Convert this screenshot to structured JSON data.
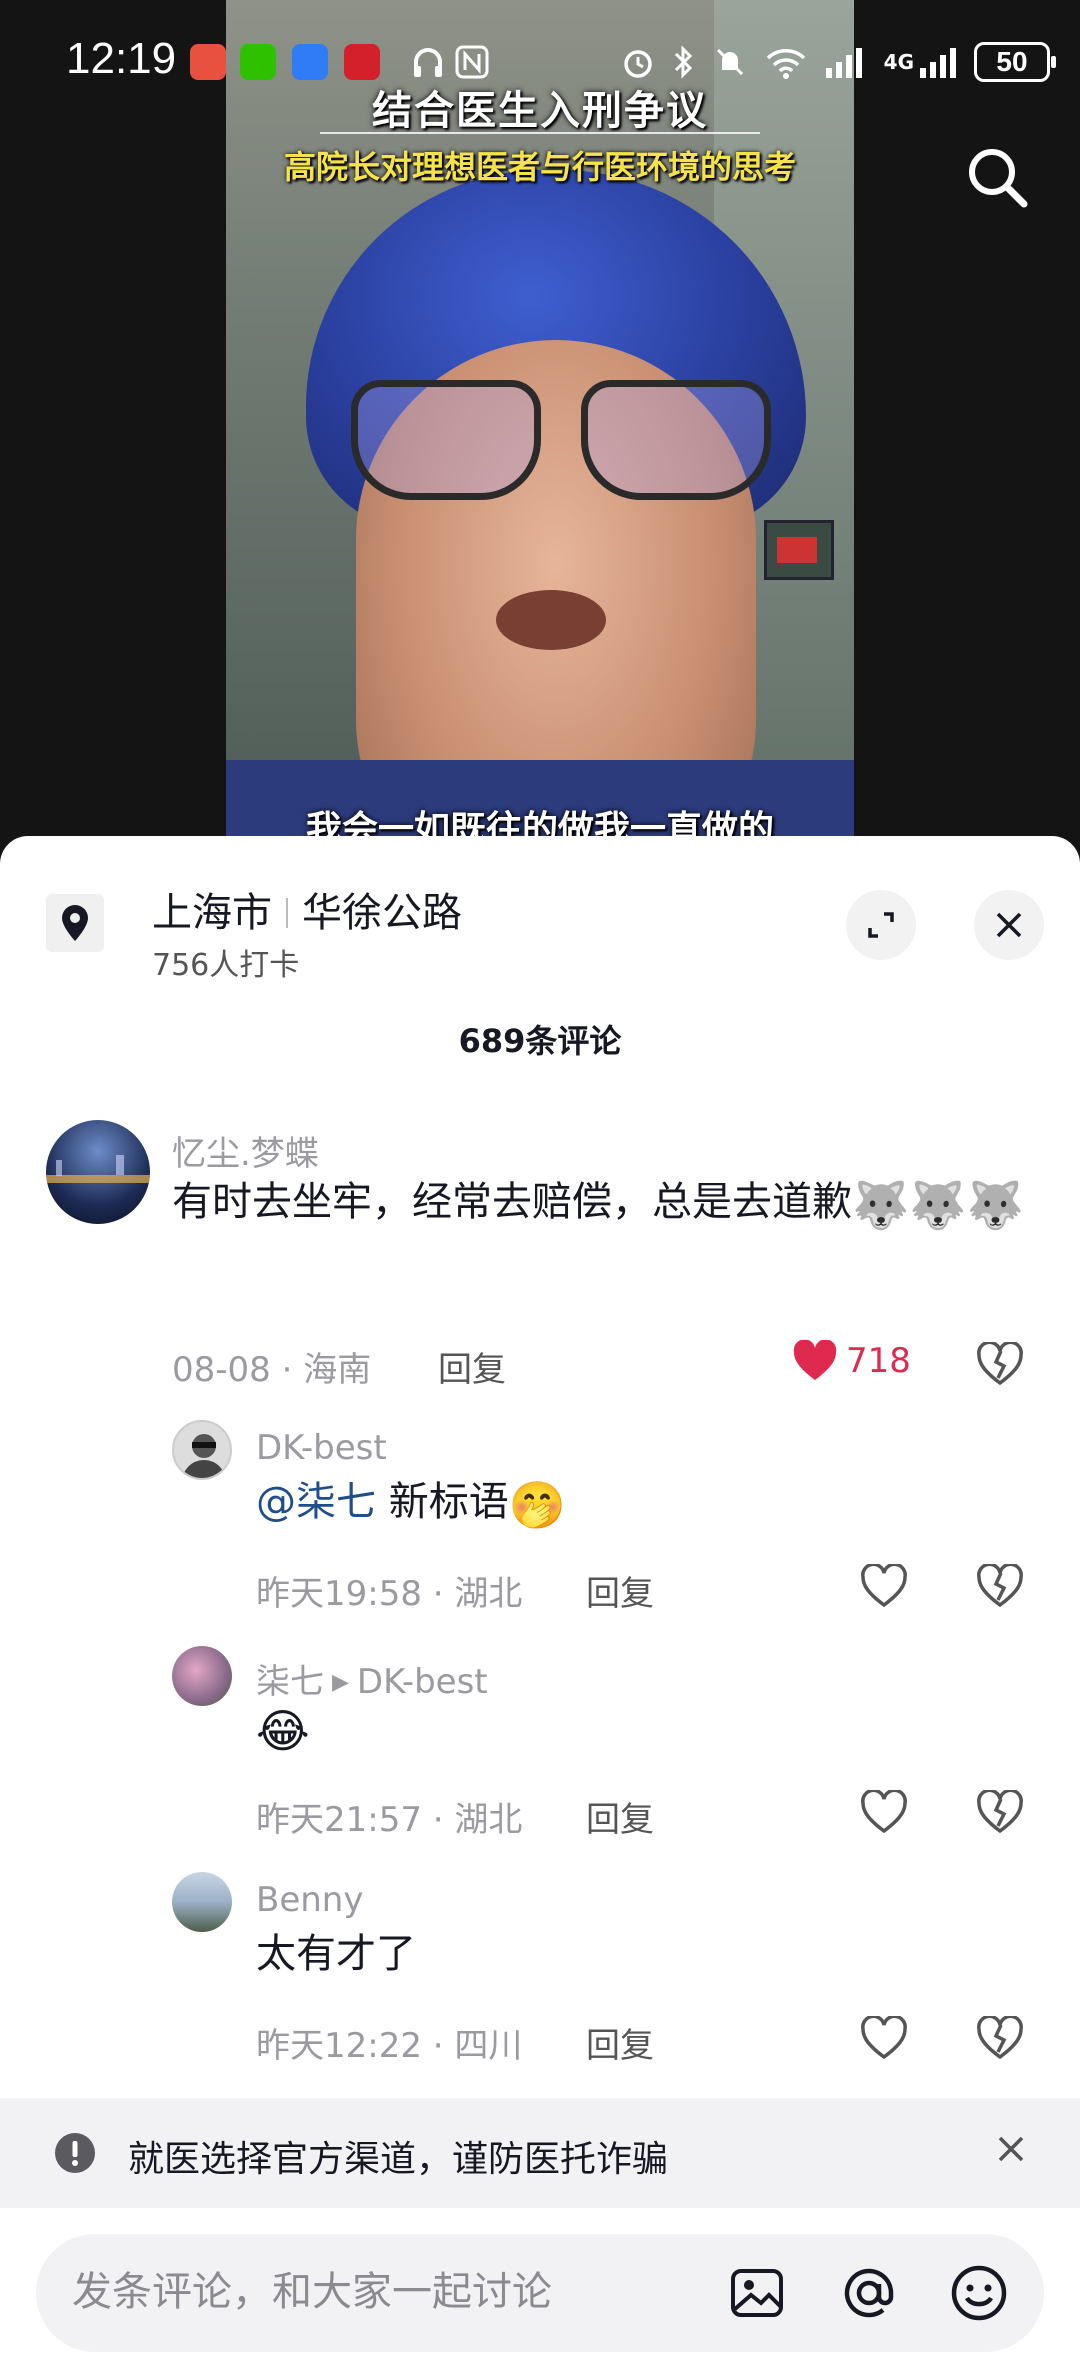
{
  "status_bar": {
    "time": "12:19",
    "battery": "50",
    "network": "4G"
  },
  "video": {
    "title": "结合医生入刑争议",
    "subtitle": "高院长对理想医者与行医环境的思考",
    "caption": "我会一如既往的做我一直做的"
  },
  "location": {
    "city": "上海市",
    "road": "华徐公路",
    "checkins": "756人打卡"
  },
  "comments_header": {
    "count_label": "689条评论"
  },
  "comments": [
    {
      "user": "忆尘.梦蝶",
      "text": "有时去坐牢，经常去赔偿，总是去道歉",
      "date": "08-08",
      "region": "海南",
      "reply": "回复",
      "likes": "718",
      "liked": true
    },
    {
      "user": "DK-best",
      "mention": "@柒七",
      "text": " 新标语",
      "date": "昨天19:58",
      "region": "湖北",
      "reply": "回复"
    },
    {
      "user": "柒七",
      "reply_to": "DK-best",
      "text": "",
      "date": "昨天21:57",
      "region": "湖北",
      "reply": "回复"
    },
    {
      "user": "Benny",
      "text": "太有才了",
      "date": "昨天12:22",
      "region": "四川",
      "reply": "回复"
    }
  ],
  "meta_separator": "·",
  "notice": {
    "text": "就医选择官方渠道，谨防医托诈骗"
  },
  "input": {
    "placeholder": "发条评论，和大家一起讨论"
  },
  "colors": {
    "like": "#e0294f",
    "mention": "#1f4e8c",
    "panel_bg": "#ffffff",
    "notice_bg": "#f2f2f4"
  },
  "icons": [
    "search-icon",
    "location-pin-icon",
    "expand-icon",
    "close-icon",
    "heart-icon",
    "dislike-heart-icon",
    "alert-icon",
    "image-icon",
    "at-icon",
    "emoji-icon"
  ]
}
